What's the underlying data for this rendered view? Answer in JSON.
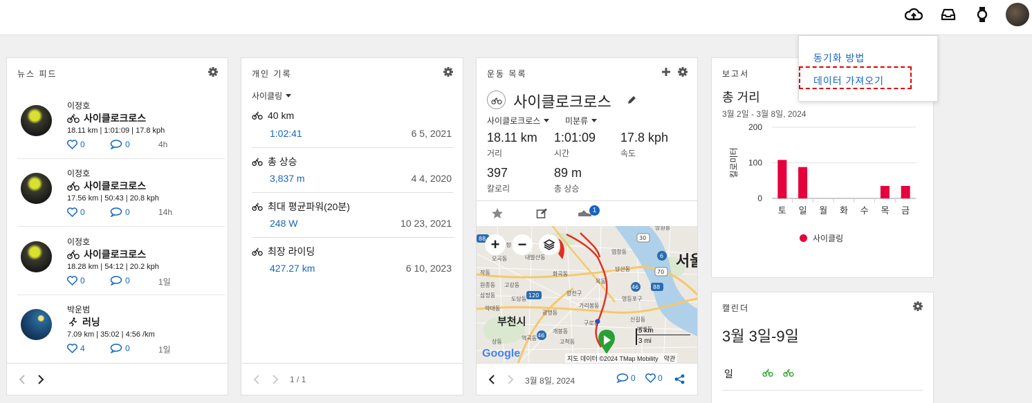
{
  "colors": {
    "link": "#1565c0",
    "bar": "#e6003c",
    "accent": "#2aa02a"
  },
  "header": {
    "icons": [
      "cloud-upload-icon",
      "inbox-icon",
      "watch-icon",
      "avatar"
    ]
  },
  "dropdown": {
    "items": [
      "동기화 방법",
      "데이터 가져오기"
    ]
  },
  "news_feed": {
    "title": "뉴스 피드",
    "items": [
      {
        "name": "이정호",
        "activity": "사이클로크로스",
        "stats": "18.11 km | 1:01:09 | 17.8 kph",
        "likes": "0",
        "comments": "0",
        "time": "4h"
      },
      {
        "name": "이정호",
        "activity": "사이클로크로스",
        "stats": "17.56 km | 50:43 | 20.8 kph",
        "likes": "0",
        "comments": "0",
        "time": "14h"
      },
      {
        "name": "이정호",
        "activity": "사이클로크로스",
        "stats": "18.28 km | 54:12 | 20.2 kph",
        "likes": "0",
        "comments": "0",
        "time": "1일"
      },
      {
        "name": "박운범",
        "activity": "러닝",
        "stats": "7.09 km | 35:02 | 4:56 /km",
        "likes": "4",
        "comments": "0",
        "time": "1일"
      }
    ]
  },
  "personal_records": {
    "title": "개인 기록",
    "filter": "사이클링",
    "items": [
      {
        "title": "40 km",
        "value": "1:02:41",
        "date": "6 5, 2021"
      },
      {
        "title": "총 상승",
        "value": "3,837 m",
        "date": "4 4, 2020"
      },
      {
        "title": "최대 평균파워(20분)",
        "value": "248 W",
        "date": "10 23, 2021"
      },
      {
        "title": "최장 라이딩",
        "value": "427.27 km",
        "date": "6 10, 2023"
      }
    ],
    "pager": "1 / 1"
  },
  "activity": {
    "title": "운동 목록",
    "name": "사이클로크로스",
    "type": "사이클로크로스",
    "category": "미분류",
    "stats": [
      {
        "value": "18.11 km",
        "label": "거리"
      },
      {
        "value": "1:01:09",
        "label": "시간"
      },
      {
        "value": "17.8 kph",
        "label": "속도"
      },
      {
        "value": "397",
        "label": "칼로리"
      },
      {
        "value": "89 m",
        "label": "총 상승"
      }
    ],
    "gear_badge": "1",
    "map": {
      "city_label": "부천시",
      "seoul_label": "서울",
      "scale_km": "5 km",
      "scale_mi": "3 mi",
      "attribution": "지도 데이터 ©2024 TMap Mobility",
      "terms": "약관",
      "brand": "Google",
      "road_labels": [
        "30",
        "6",
        "70",
        "88",
        "46",
        "120",
        "46",
        "88"
      ],
      "place_labels": [
        "오곡동",
        "내발산동",
        "화곡동",
        "목동",
        "양천구",
        "영등포구",
        "신길동",
        "대방동",
        "광명동",
        "가리봉동",
        "구로동",
        "역곡동",
        "작동",
        "오정동",
        "원종동",
        "고강동",
        "삼정동",
        "약대동",
        "도당동",
        "상동",
        "개봉동",
        "고척동",
        "염창동",
        "당산동",
        "망원동"
      ]
    },
    "date": "3월 8일, 2024",
    "comments": "0",
    "likes": "0"
  },
  "report": {
    "title": "보고서",
    "metric": "총 거리",
    "range": "3월 2일 - 3월 8일, 2024",
    "legend": "사이클링"
  },
  "chart_data": {
    "type": "bar",
    "categories": [
      "토",
      "일",
      "월",
      "화",
      "수",
      "목",
      "금"
    ],
    "series": [
      {
        "name": "사이클링",
        "values": [
          108,
          88,
          0,
          0,
          0,
          35,
          35
        ]
      }
    ],
    "ylabel": "킬로미터",
    "ylim": [
      0,
      200
    ],
    "yticks": [
      0,
      100,
      200
    ],
    "grid": true,
    "legend": "bottom"
  },
  "calendar": {
    "title": "캘린더",
    "range": "3월 3일-9일",
    "day": "일"
  }
}
